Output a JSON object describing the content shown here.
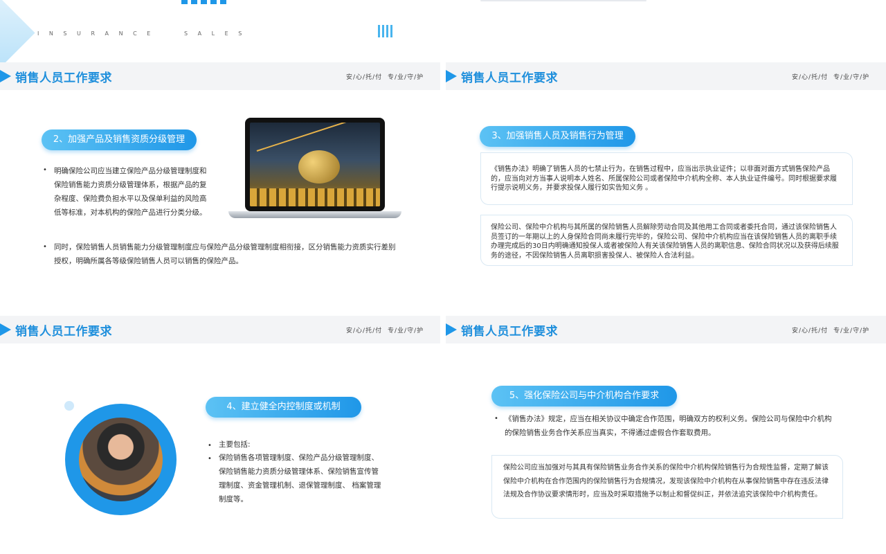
{
  "top_banner": {
    "subtitle": "I N S U R A N C E     S A L E S"
  },
  "header": {
    "title": "销售人员工作要求",
    "tag1": "安/心/托/付",
    "tag2": "专/业/守/护"
  },
  "section2": {
    "pill": "2、加强产品及销售资质分级管理",
    "bullet1": "明确保险公司应当建立保险产品分级管理制度和保险销售能力资质分级管理体系，根据产品的复杂程度、保险费负担水平以及保单利益的风险高低等标准，对本机构的保险产品进行分类分级。",
    "bullet2": "同时，保险销售人员销售能力分级管理制度应与保险产品分级管理制度相衔接，区分销售能力资质实行差别授权，明确所属各等级保险销售人员可以销售的保险产品。"
  },
  "section3": {
    "pill": "3、加强销售人员及销售行为管理",
    "box1": "《销售办法》明确了销售人员的七禁止行为，在销售过程中，应当出示执业证件；以非面对面方式销售保险产品的，应当向对方当事人说明本人姓名、所属保险公司或者保险中介机构全称、本人执业证件编号。同时根据要求履行提示说明义务，并要求投保人履行如实告知义务 。",
    "box2": "保险公司、保险中介机构与其所属的保险销售人员解除劳动合同及其他用工合同或者委托合同，通过该保险销售人员签订的一年期以上的人身保险合同尚未履行完毕的，保险公司、保险中介机构应当在该保险销售人员的离职手续办理完成后的30日内明确通知投保人或者被保险人有关该保险销售人员的离职信息、保险合同状况以及获得后续服务的途径，不因保险销售人员离职损害投保人、被保险人合法利益。"
  },
  "section4": {
    "pill": "4、建立健全内控制度或机制",
    "bullet1": "主要包括:",
    "bullet2": "保险销售各项管理制度、保险产品分级管理制度、保险销售能力资质分级管理体系、保险销售宣传管理制度、资金管理机制、退保管理制度、 档案管理制度等。"
  },
  "section5": {
    "pill": "5、强化保险公司与中介机构合作要求",
    "bullet1": "《销售办法》规定，应当在相关协议中确定合作范围，明确双方的权利义务。保险公司与保险中介机构的保险销售业务合作关系应当真实，不得通过虚假合作套取费用。",
    "box1": "保险公司应当加强对与其具有保险销售业务合作关系的保险中介机构保险销售行为合规性监督，定期了解该保险中介机构在合作范围内的保险销售行为合规情况，发现该保险中介机构在从事保险销售中存在违反法律法规及合作协议要求情形时，应当及时采取措施予以制止和督促纠正，并依法追究该保险中介机构责任。"
  },
  "colors": {
    "accent": "#1f97e8",
    "accent_light": "#5cc2f4",
    "header_bg": "#f3f4f6"
  }
}
